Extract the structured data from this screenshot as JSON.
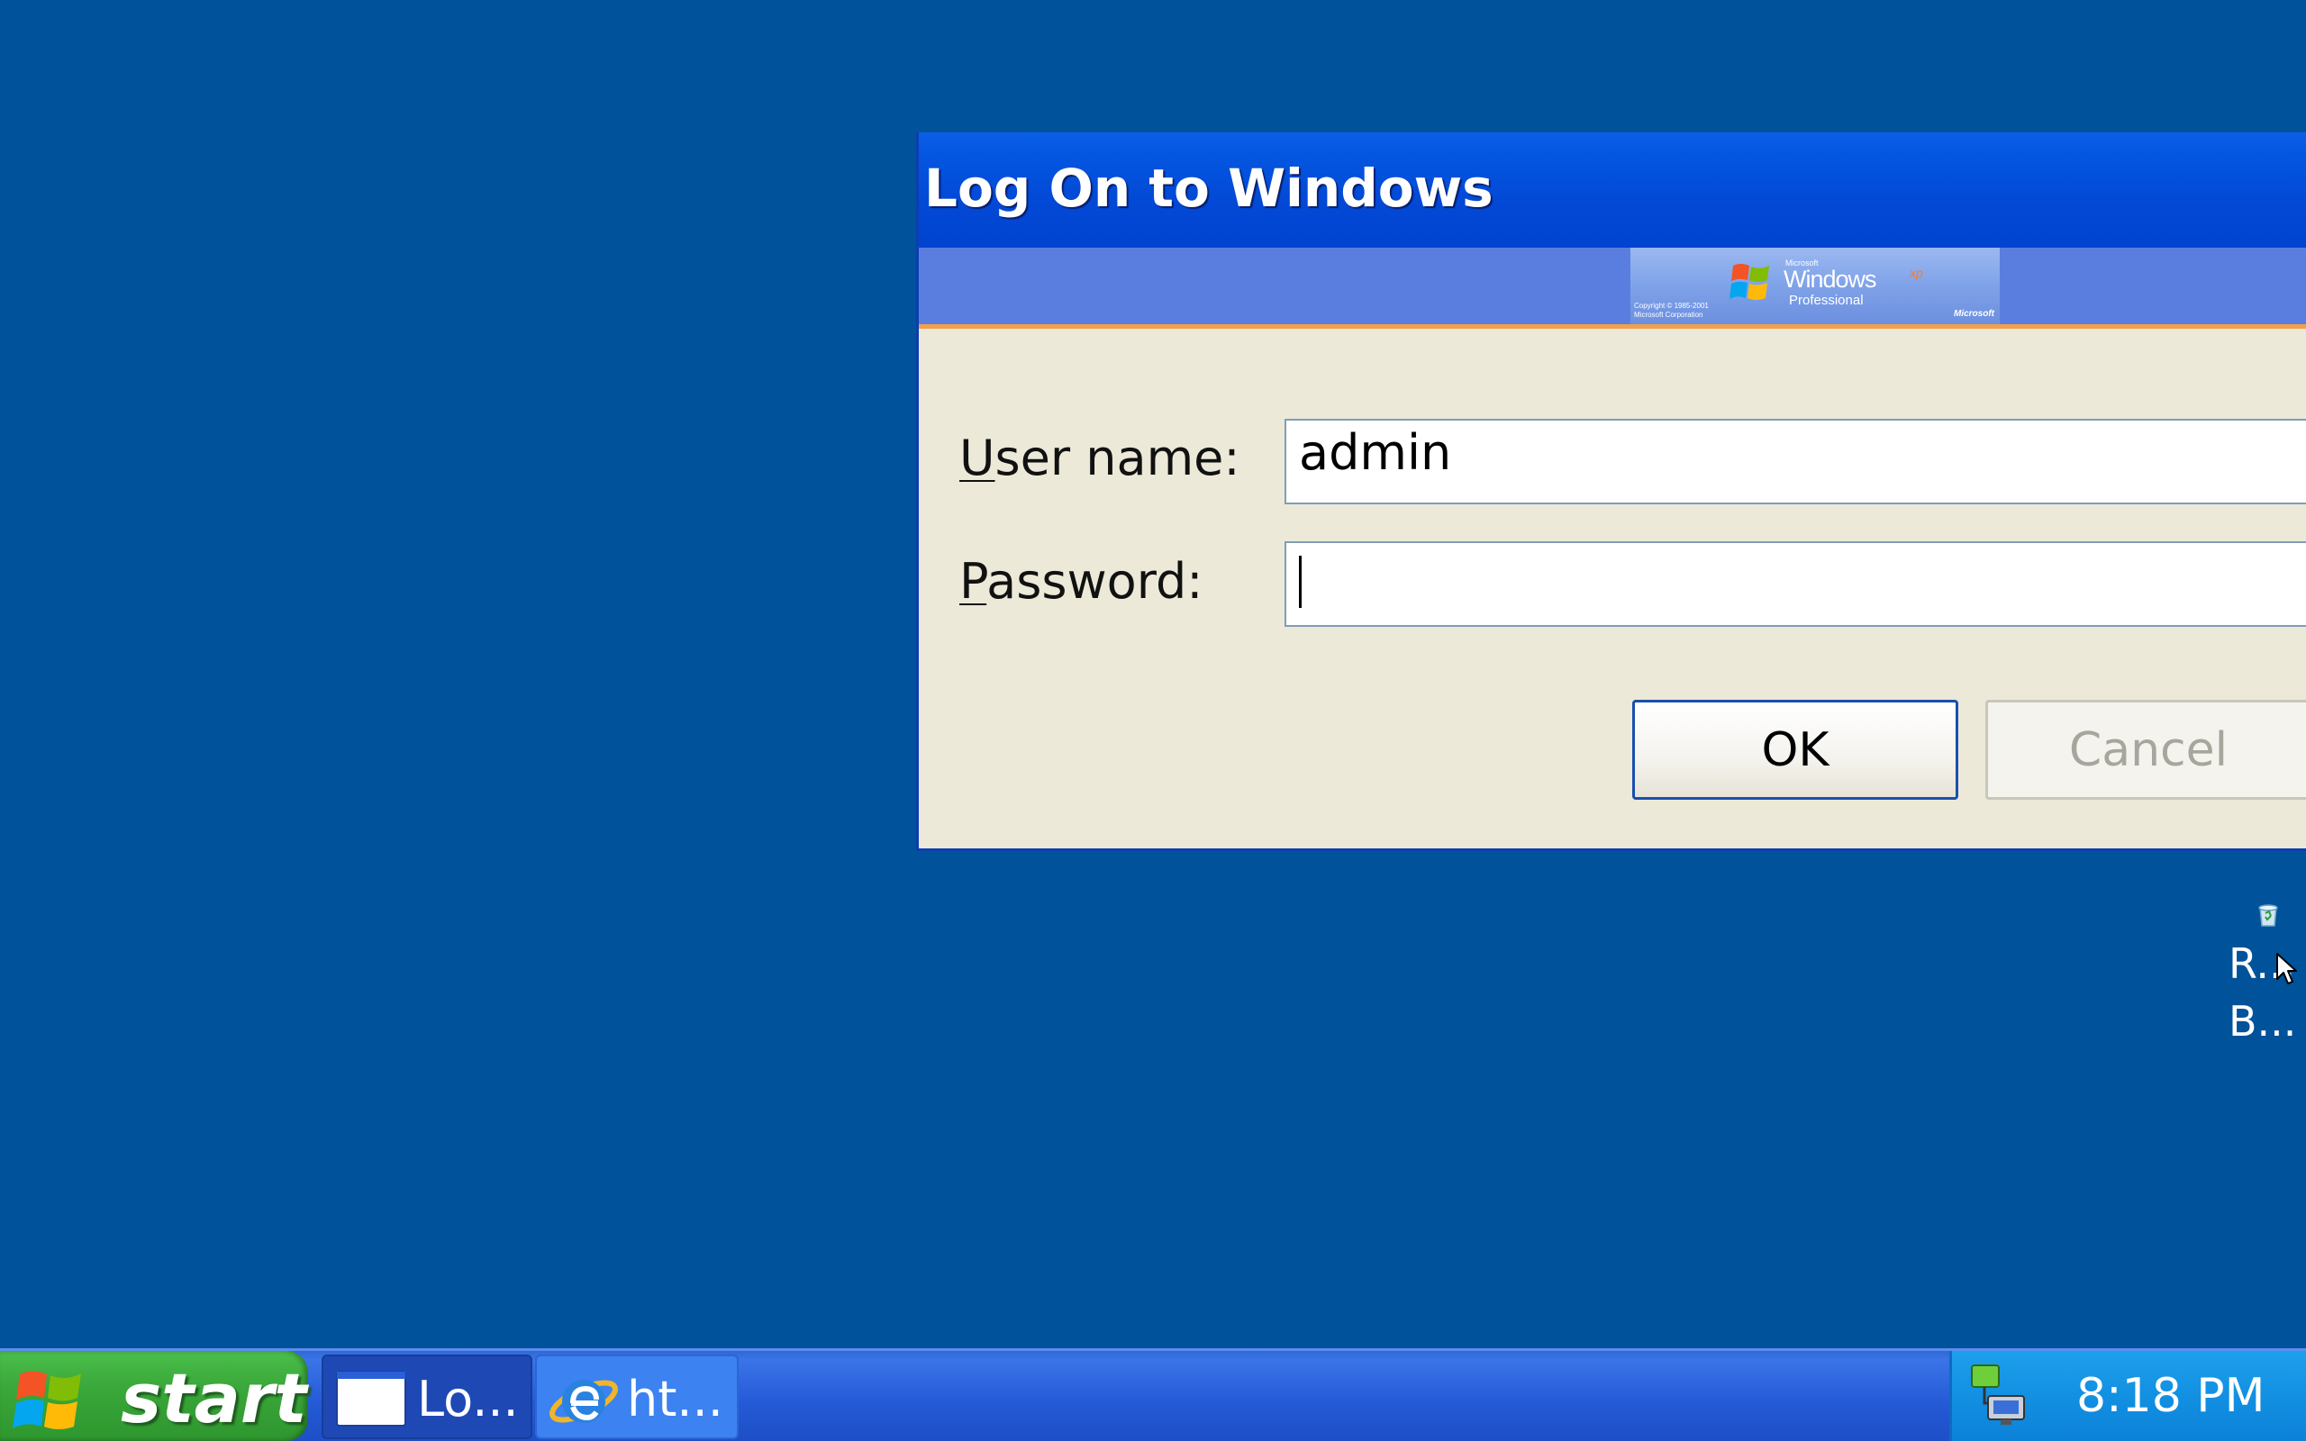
{
  "dialog": {
    "title": "Log On to Windows",
    "banner": {
      "microsoft_small": "Microsoft",
      "windows": "Windows",
      "xp": "xp",
      "edition": "Professional",
      "copyright_line1": "Copyright © 1985-2001",
      "copyright_line2": "Microsoft Corporation",
      "microsoft": "Microsoft"
    },
    "user_name": {
      "label_access_key": "U",
      "label_rest": "ser name:",
      "value": "admin"
    },
    "password": {
      "label_access_key": "P",
      "label_rest": "assword:",
      "value": ""
    },
    "ok_label": "OK",
    "cancel_label": "Cancel"
  },
  "desktop": {
    "icon": {
      "name": "recycle-bin-icon",
      "label_line1": "R...",
      "label_line2": "B..."
    }
  },
  "taskbar": {
    "start_label": "start",
    "tasks": [
      {
        "icon": "window-icon",
        "label": "Lo..."
      },
      {
        "icon": "internet-explorer-icon",
        "label": "ht..."
      }
    ],
    "tray": {
      "icons": [
        "network-icon"
      ],
      "clock": "8:18 PM"
    }
  },
  "colors": {
    "desktop_bg": "#00529b",
    "titlebar": "#0249d6",
    "dialog_bg": "#ece9d8",
    "start_green": "#3aa83a",
    "taskbar_blue": "#2459d6",
    "tray_blue": "#1290e2"
  }
}
